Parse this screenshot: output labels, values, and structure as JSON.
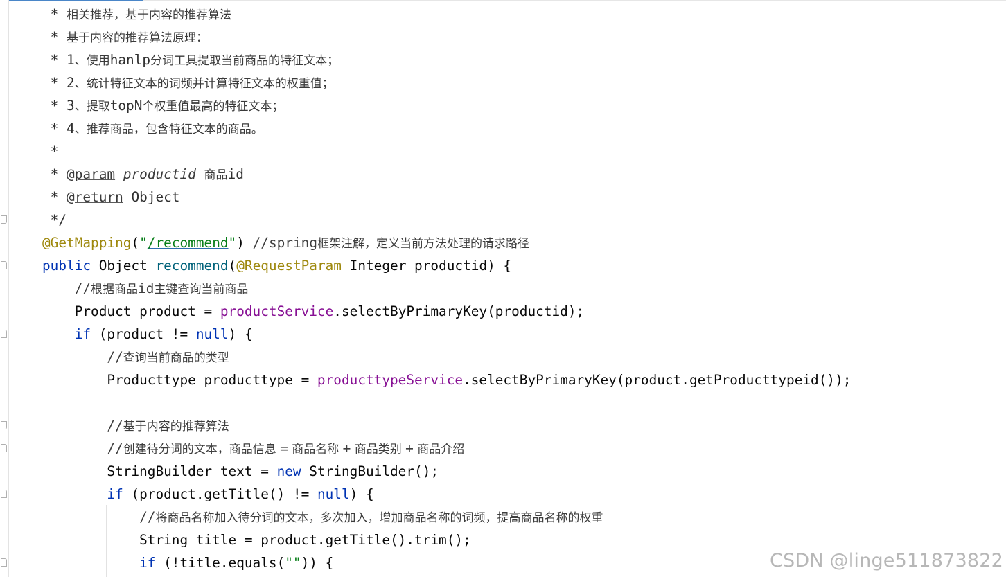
{
  "editor": {
    "lines": [
      {
        "id": "l1",
        "parts": [
          {
            "t": " * ",
            "c": "doc"
          },
          {
            "t": "相关推荐，基于内容的推荐算法",
            "c": "doc-text"
          }
        ]
      },
      {
        "id": "l2",
        "parts": [
          {
            "t": " * ",
            "c": "doc"
          },
          {
            "t": "基于内容的推荐算法原理：",
            "c": "doc-text"
          }
        ]
      },
      {
        "id": "l3",
        "parts": [
          {
            "t": " * 1",
            "c": "doc"
          },
          {
            "t": "、使用",
            "c": "doc-text"
          },
          {
            "t": "hanlp",
            "c": "doc"
          },
          {
            "t": "分词工具提取当前商品的特征文本；",
            "c": "doc-text"
          }
        ]
      },
      {
        "id": "l4",
        "parts": [
          {
            "t": " * 2",
            "c": "doc"
          },
          {
            "t": "、统计特征文本的词频并计算特征文本的权重值；",
            "c": "doc-text"
          }
        ]
      },
      {
        "id": "l5",
        "parts": [
          {
            "t": " * 3",
            "c": "doc"
          },
          {
            "t": "、提取",
            "c": "doc-text"
          },
          {
            "t": "topN",
            "c": "doc"
          },
          {
            "t": "个权重值最高的特征文本；",
            "c": "doc-text"
          }
        ]
      },
      {
        "id": "l6",
        "parts": [
          {
            "t": " * 4",
            "c": "doc"
          },
          {
            "t": "、推荐商品，包含特征文本的商品。",
            "c": "doc-text"
          }
        ]
      },
      {
        "id": "l7",
        "parts": [
          {
            "t": " *",
            "c": "doc"
          }
        ]
      },
      {
        "id": "l8",
        "parts": [
          {
            "t": " * ",
            "c": "doc"
          },
          {
            "t": "@param",
            "c": "doc-tag"
          },
          {
            "t": " ",
            "c": "doc"
          },
          {
            "t": "productid",
            "c": "doc-param"
          },
          {
            "t": " ",
            "c": "doc"
          },
          {
            "t": "商品",
            "c": "doc-text"
          },
          {
            "t": "id",
            "c": "doc"
          }
        ]
      },
      {
        "id": "l9",
        "parts": [
          {
            "t": " * ",
            "c": "doc"
          },
          {
            "t": "@return",
            "c": "doc-tag"
          },
          {
            "t": " Object",
            "c": "doc"
          }
        ]
      },
      {
        "id": "l10",
        "parts": [
          {
            "t": " */",
            "c": "doc"
          }
        ]
      },
      {
        "id": "l11",
        "parts": [
          {
            "t": "@GetMapping",
            "c": "annotation"
          },
          {
            "t": "(",
            "c": "plain"
          },
          {
            "t": "\"",
            "c": "string"
          },
          {
            "t": "/recommend",
            "c": "string-link"
          },
          {
            "t": "\"",
            "c": "string"
          },
          {
            "t": ") ",
            "c": "plain"
          },
          {
            "t": "//spring",
            "c": "comment"
          },
          {
            "t": "框架注解，定义当前方法处理的请求路径",
            "c": "comment-cn"
          }
        ]
      },
      {
        "id": "l12",
        "parts": [
          {
            "t": "public",
            "c": "keyword"
          },
          {
            "t": " Object ",
            "c": "plain"
          },
          {
            "t": "recommend",
            "c": "method-decl"
          },
          {
            "t": "(",
            "c": "plain"
          },
          {
            "t": "@RequestParam",
            "c": "annotation"
          },
          {
            "t": " Integer productid) {",
            "c": "plain"
          }
        ]
      },
      {
        "id": "l13",
        "parts": [
          {
            "t": "    //",
            "c": "comment"
          },
          {
            "t": "根据商品",
            "c": "comment-cn"
          },
          {
            "t": "id",
            "c": "comment"
          },
          {
            "t": "主键查询当前商品",
            "c": "comment-cn"
          }
        ]
      },
      {
        "id": "l14",
        "parts": [
          {
            "t": "    Product product = ",
            "c": "plain"
          },
          {
            "t": "productService",
            "c": "field"
          },
          {
            "t": ".selectByPrimaryKey(productid);",
            "c": "plain"
          }
        ]
      },
      {
        "id": "l15",
        "parts": [
          {
            "t": "    ",
            "c": "plain"
          },
          {
            "t": "if",
            "c": "keyword"
          },
          {
            "t": " (product != ",
            "c": "plain"
          },
          {
            "t": "null",
            "c": "keyword"
          },
          {
            "t": ") {",
            "c": "plain"
          }
        ]
      },
      {
        "id": "l16",
        "parts": [
          {
            "t": "        //",
            "c": "comment"
          },
          {
            "t": "查询当前商品的类型",
            "c": "comment-cn"
          }
        ]
      },
      {
        "id": "l17",
        "parts": [
          {
            "t": "        Producttype producttype = ",
            "c": "plain"
          },
          {
            "t": "producttypeService",
            "c": "field"
          },
          {
            "t": ".selectByPrimaryKey(product.getProducttypeid());",
            "c": "plain"
          }
        ]
      },
      {
        "id": "l18",
        "parts": [
          {
            "t": "",
            "c": "plain"
          }
        ]
      },
      {
        "id": "l19",
        "parts": [
          {
            "t": "        //",
            "c": "comment"
          },
          {
            "t": "基于内容的推荐算法",
            "c": "comment-cn"
          }
        ]
      },
      {
        "id": "l20",
        "parts": [
          {
            "t": "        //",
            "c": "comment"
          },
          {
            "t": "创建待分词的文本，商品信息 ",
            "c": "comment-cn"
          },
          {
            "t": "=",
            "c": "comment"
          },
          {
            "t": " 商品名称 ",
            "c": "comment-cn"
          },
          {
            "t": "+",
            "c": "comment"
          },
          {
            "t": " 商品类别 ",
            "c": "comment-cn"
          },
          {
            "t": "+",
            "c": "comment"
          },
          {
            "t": " 商品介绍",
            "c": "comment-cn"
          }
        ]
      },
      {
        "id": "l21",
        "parts": [
          {
            "t": "        StringBuilder text = ",
            "c": "plain"
          },
          {
            "t": "new",
            "c": "keyword"
          },
          {
            "t": " StringBuilder();",
            "c": "plain"
          }
        ]
      },
      {
        "id": "l22",
        "parts": [
          {
            "t": "        ",
            "c": "plain"
          },
          {
            "t": "if",
            "c": "keyword"
          },
          {
            "t": " (product.getTitle() != ",
            "c": "plain"
          },
          {
            "t": "null",
            "c": "keyword"
          },
          {
            "t": ") {",
            "c": "plain"
          }
        ]
      },
      {
        "id": "l23",
        "parts": [
          {
            "t": "            //",
            "c": "comment"
          },
          {
            "t": "将商品名称加入待分词的文本，多次加入，增加商品名称的词频，提高商品名称的权重",
            "c": "comment-cn"
          }
        ]
      },
      {
        "id": "l24",
        "parts": [
          {
            "t": "            String title = product.getTitle().trim();",
            "c": "plain"
          }
        ]
      },
      {
        "id": "l25",
        "parts": [
          {
            "t": "            ",
            "c": "plain"
          },
          {
            "t": "if",
            "c": "keyword"
          },
          {
            "t": " (!title.equals(",
            "c": "plain"
          },
          {
            "t": "\"\"",
            "c": "string"
          },
          {
            "t": ")) {",
            "c": "plain"
          }
        ]
      }
    ]
  },
  "watermark": "CSDN @linge511873822"
}
